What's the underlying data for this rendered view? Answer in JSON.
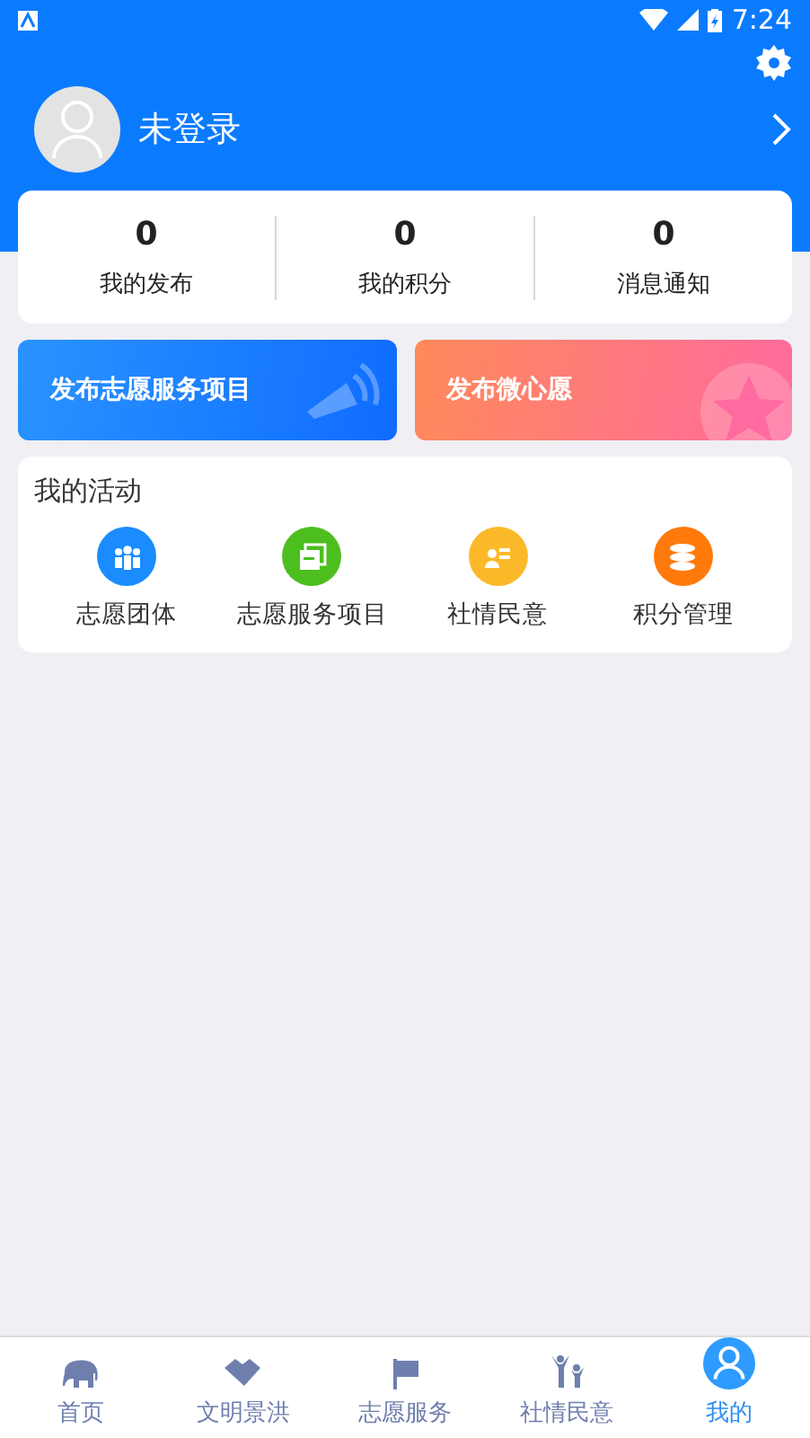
{
  "status_bar": {
    "time": "7:24"
  },
  "profile": {
    "name": "未登录"
  },
  "stats": [
    {
      "value": "0",
      "label": "我的发布"
    },
    {
      "value": "0",
      "label": "我的积分"
    },
    {
      "value": "0",
      "label": "消息通知"
    }
  ],
  "banners": [
    "发布志愿服务项目",
    "发布微心愿"
  ],
  "activities": {
    "title": "我的活动",
    "items": [
      "志愿团体",
      "志愿服务项目",
      "社情民意",
      "积分管理"
    ]
  },
  "nav": [
    {
      "label": "首页",
      "selected": false
    },
    {
      "label": "文明景洪",
      "selected": false
    },
    {
      "label": "志愿服务",
      "selected": false
    },
    {
      "label": "社情民意",
      "selected": false
    },
    {
      "label": "我的",
      "selected": true
    }
  ]
}
